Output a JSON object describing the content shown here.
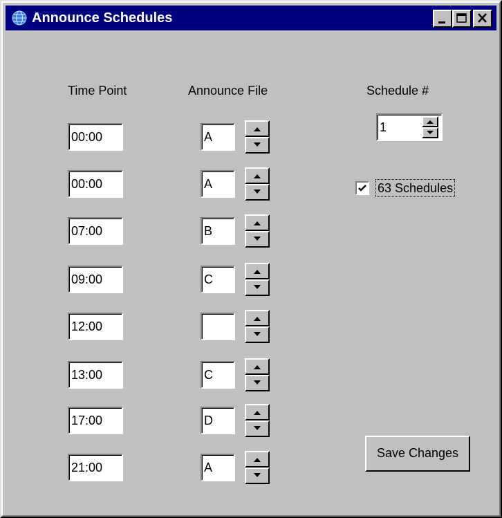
{
  "window": {
    "title": "Announce Schedules"
  },
  "headers": {
    "time_point": "Time Point",
    "announce_file": "Announce File",
    "schedule_number": "Schedule #"
  },
  "rows": [
    {
      "time": "00:00",
      "file": "A"
    },
    {
      "time": "00:00",
      "file": "A"
    },
    {
      "time": "07:00",
      "file": "B"
    },
    {
      "time": "09:00",
      "file": "C"
    },
    {
      "time": "12:00",
      "file": ""
    },
    {
      "time": "13:00",
      "file": "C"
    },
    {
      "time": "17:00",
      "file": "D"
    },
    {
      "time": "21:00",
      "file": "A"
    }
  ],
  "schedule": {
    "value": "1"
  },
  "checkbox": {
    "label": "63 Schedules",
    "checked": true
  },
  "buttons": {
    "save": "Save Changes"
  },
  "colors": {
    "titlebar": "#000080",
    "face": "#c0c0c0"
  }
}
